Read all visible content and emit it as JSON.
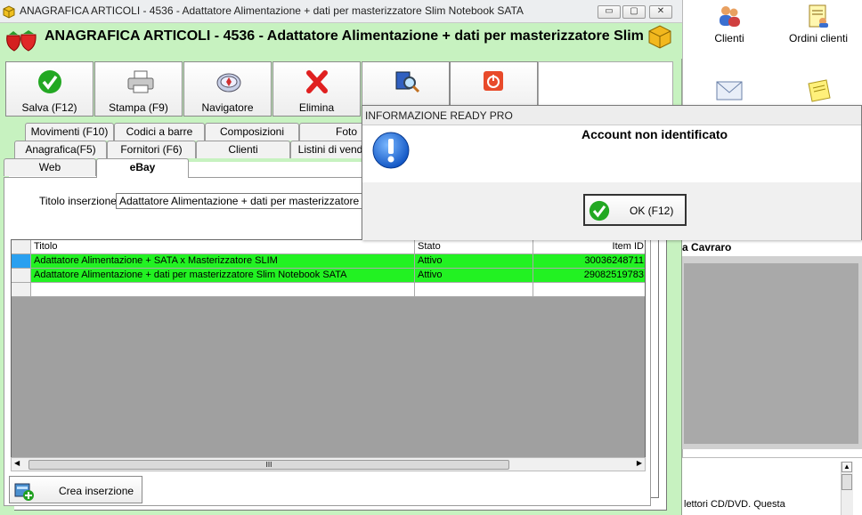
{
  "bg_app": {
    "dock": [
      {
        "label": "Clienti",
        "icon": "users-icon"
      },
      {
        "label": "Ordini clienti",
        "icon": "orders-icon"
      },
      {
        "label": "",
        "icon": "mail-icon"
      },
      {
        "label": "",
        "icon": "notes-icon"
      }
    ],
    "panel_header": "a Cavraro",
    "desc_text": "lettori CD/DVD. Questa"
  },
  "window": {
    "title": "ANAGRAFICA ARTICOLI - 4536 - Adattatore Alimentazione + dati per masterizzatore Slim Notebook SATA",
    "controls": {
      "minimize": "▭",
      "maximize": "▢",
      "close": "✕"
    }
  },
  "header": {
    "title": "ANAGRAFICA ARTICOLI - 4536 - Adattatore Alimentazione + dati per masterizzatore Slim"
  },
  "toolbar": [
    {
      "label": "Salva (F12)",
      "icon": "check-icon"
    },
    {
      "label": "Stampa (F9)",
      "icon": "printer-icon"
    },
    {
      "label": "Navigatore",
      "icon": "compass-icon"
    },
    {
      "label": "Elimina",
      "icon": "delete-icon"
    },
    {
      "label": "",
      "icon": "search-book-icon"
    },
    {
      "label": "",
      "icon": "power-icon"
    }
  ],
  "tabs": {
    "row1": [
      "Movimenti (F10)",
      "Codici a barre",
      "Composizioni",
      "Foto"
    ],
    "row2": [
      "Anagrafica(F5)",
      "Fornitori (F6)",
      "Clienti",
      "Listini di vend"
    ],
    "row3": [
      "Web",
      "eBay"
    ],
    "active": "eBay"
  },
  "form": {
    "titolo_label": "Titolo inserzione :",
    "titolo_value": "Adattatore Alimentazione + dati per masterizzatore Slim No"
  },
  "grid": {
    "columns": [
      "Titolo",
      "Stato",
      "Item ID"
    ],
    "rows": [
      {
        "titolo": "Adattatore Alimentazione + SATA x Masterizzatore SLIM",
        "stato": "Attivo",
        "item_id": "30036248711"
      },
      {
        "titolo": "Adattatore Alimentazione + dati per masterizzatore Slim Notebook SATA",
        "stato": "Attivo",
        "item_id": "29082519783"
      }
    ],
    "scroll_thumb": "III"
  },
  "crea_button": {
    "label": "Crea inserzione"
  },
  "dialog": {
    "title": "INFORMAZIONE READY PRO",
    "message": "Account non identificato",
    "ok_label": "OK (F12)"
  }
}
